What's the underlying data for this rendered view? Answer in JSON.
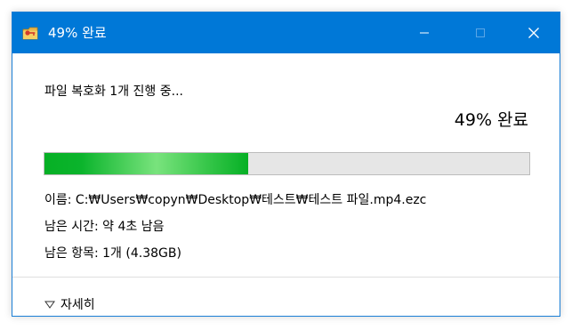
{
  "window": {
    "title": "49% 완료",
    "accent_color": "#0078d7",
    "icons": {
      "app": "folder-key-icon",
      "minimize": "minimize-icon",
      "maximize": "maximize-icon",
      "close": "close-icon"
    }
  },
  "operation": {
    "heading": "파일 복호화 1개 진행 중...",
    "percent_label": "49% 완료",
    "progress_fraction": 0.42,
    "progress_color": "#06b025"
  },
  "details": {
    "name_line": "이름: C:₩Users₩copyn₩Desktop₩테스트₩테스트 파일.mp4.ezc",
    "time_line": "남은 시간: 약 4초 남음",
    "items_line": "남은 항목: 1개 (4.38GB)"
  },
  "footer": {
    "toggle_label": "자세히",
    "toggle_icon": "triangle-down-icon"
  }
}
